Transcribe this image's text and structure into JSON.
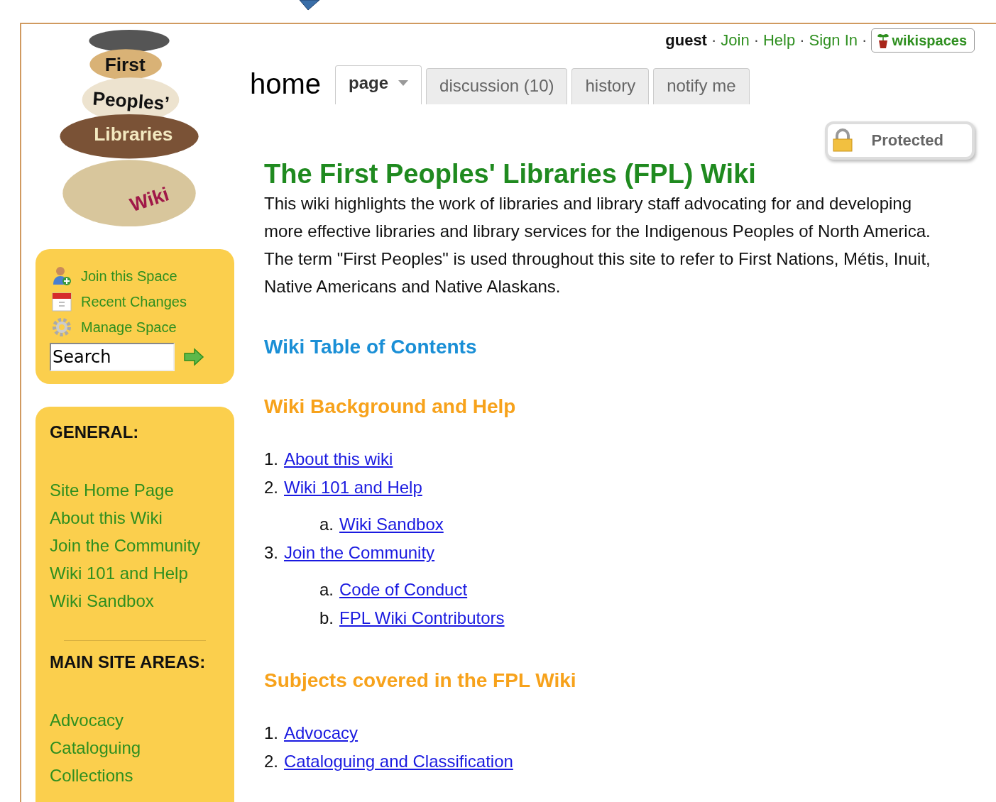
{
  "user_bar": {
    "user": "guest",
    "separator": "·",
    "links": [
      "Join",
      "Help",
      "Sign In"
    ],
    "brand": "wikispaces"
  },
  "page_title": "home",
  "tabs": [
    {
      "label": "page",
      "selected": true,
      "dropdown": true
    },
    {
      "label": "discussion (10)",
      "selected": false,
      "dropdown": false
    },
    {
      "label": "history",
      "selected": false,
      "dropdown": false
    },
    {
      "label": "notify me",
      "selected": false,
      "dropdown": false
    }
  ],
  "protected_badge": "Protected",
  "logo": {
    "words": [
      "First",
      "Peoples’",
      "Libraries",
      "Wiki"
    ]
  },
  "actions": [
    {
      "kind": "join",
      "label": "Join this Space"
    },
    {
      "kind": "changes",
      "label": "Recent Changes"
    },
    {
      "kind": "manage",
      "label": "Manage Space"
    }
  ],
  "search": {
    "value": "Search"
  },
  "sidebar_sections": [
    {
      "heading": "GENERAL:",
      "links": [
        "Site Home Page",
        "About this Wiki",
        "Join the Community",
        "Wiki 101 and Help",
        "Wiki Sandbox"
      ]
    },
    {
      "heading": "MAIN SITE AREAS:",
      "links": [
        "Advocacy",
        "Cataloguing",
        "Collections"
      ]
    }
  ],
  "article": {
    "title": "The First Peoples' Libraries (FPL) Wiki",
    "intro": "This wiki highlights the work of libraries and library staff advocating for and developing more effective libraries and library services for the Indigenous Peoples of North America. The term \"First Peoples\" is used throughout this site to refer to First Nations, Métis, Inuit, Native Americans and Native Alaskans.",
    "sections": [
      {
        "kind": "toc",
        "heading": "Wiki Table of Contents"
      },
      {
        "kind": "subhead",
        "heading": "Wiki Background and Help",
        "items": [
          {
            "marker": "1.",
            "label": "About this wiki"
          },
          {
            "marker": "2.",
            "label": "Wiki 101 and Help",
            "children": [
              {
                "marker": "a.",
                "label": "Wiki Sandbox"
              }
            ]
          },
          {
            "marker": "3.",
            "label": "Join the Community",
            "children": [
              {
                "marker": "a.",
                "label": "Code of Conduct"
              },
              {
                "marker": "b.",
                "label": "FPL Wiki Contributors"
              }
            ]
          }
        ]
      },
      {
        "kind": "subhead",
        "heading": "Subjects covered in the FPL Wiki",
        "items": [
          {
            "marker": "1.",
            "label": "Advocacy"
          },
          {
            "marker": "2.",
            "label": "Cataloguing and Classification"
          }
        ]
      }
    ]
  }
}
